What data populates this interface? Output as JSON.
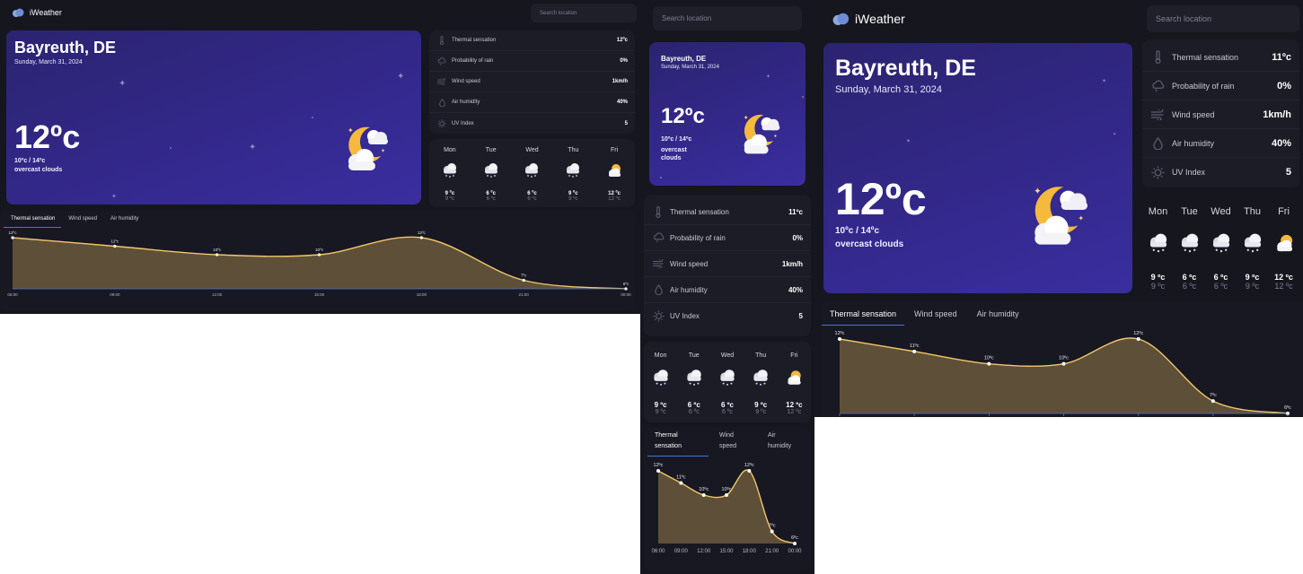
{
  "app": {
    "name": "iWeather"
  },
  "search": {
    "placeholder": "Search location"
  },
  "hero": {
    "city": "Bayreuth, DE",
    "date": "Sunday, March 31, 2024",
    "temperature": "12ºc",
    "range": "10ºc / 14ºc",
    "description": "overcast clouds",
    "icon": "moon-cloud-icon"
  },
  "details": {
    "thermal_sensation_compact": {
      "label": "Thermal sensation",
      "value": "12ºc",
      "icon": "thermometer-icon"
    },
    "thermal_sensation": {
      "label": "Thermal sensation",
      "value": "11ºc",
      "icon": "thermometer-icon"
    },
    "rain": {
      "label": "Probability of rain",
      "value": "0%",
      "icon": "cloud-rain-icon"
    },
    "wind": {
      "label": "Wind speed",
      "value": "1km/h",
      "icon": "wind-icon"
    },
    "humidity": {
      "label": "Air humidity",
      "value": "40%",
      "icon": "drop-icon"
    },
    "uv": {
      "label": "UV Index",
      "value": "5",
      "icon": "sun-icon"
    }
  },
  "forecast": [
    {
      "day": "Mon",
      "max": "9 ºc",
      "min": "9 ºc",
      "icon": "snow-cloud-icon"
    },
    {
      "day": "Tue",
      "max": "6 ºc",
      "min": "6 ºc",
      "icon": "snow-cloud-icon"
    },
    {
      "day": "Wed",
      "max": "6 ºc",
      "min": "6 ºc",
      "icon": "snow-cloud-icon"
    },
    {
      "day": "Thu",
      "max": "9 ºc",
      "min": "9 ºc",
      "icon": "snow-cloud-icon"
    },
    {
      "day": "Fri",
      "max": "12 ºc",
      "min": "12 ºc",
      "icon": "sun-cloud-icon"
    }
  ],
  "tabs": {
    "thermal": "Thermal sensation",
    "wind": "Wind speed",
    "humidity": "Air humidity",
    "thermal_line1": "Thermal",
    "thermal_line2": "sensation",
    "wind_line1": "Wind",
    "wind_line2": "speed",
    "humidity_line1": "Air",
    "humidity_line2": "humidity"
  },
  "colors": {
    "background": "#16161f",
    "card": "#1c1c27",
    "line": "#f2c66a",
    "area": "#6b5a3c",
    "tab_active": "#4e6fd9"
  },
  "chart_data": {
    "type": "area",
    "x": [
      "06:00",
      "09:00",
      "12:00",
      "15:00",
      "18:00",
      "21:00",
      "00:00"
    ],
    "series": [
      {
        "values": [
          12,
          11,
          10,
          10,
          12,
          7,
          6
        ]
      }
    ],
    "labels": [
      "12ºc",
      "11ºc",
      "10ºc",
      "10ºc",
      "12ºc",
      "7ºc",
      "6ºc"
    ],
    "ylim": [
      6,
      12
    ],
    "grid": false
  }
}
